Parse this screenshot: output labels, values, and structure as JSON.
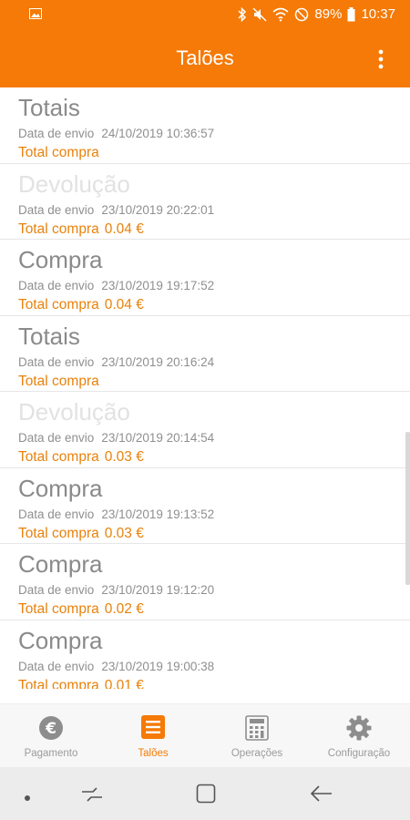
{
  "status_bar": {
    "battery": "89%",
    "time": "10:37"
  },
  "toolbar": {
    "title": "Talões"
  },
  "receipts": [
    {
      "type": "Totais",
      "date_label": "Data de envio",
      "date": "24/10/2019 10:36:57",
      "total_label": "Total compra",
      "amount": "",
      "faded": false
    },
    {
      "type": "Devolução",
      "date_label": "Data de envio",
      "date": "23/10/2019 20:22:01",
      "total_label": "Total compra",
      "amount": "0.04 €",
      "faded": true
    },
    {
      "type": "Compra",
      "date_label": "Data de envio",
      "date": "23/10/2019 19:17:52",
      "total_label": "Total compra",
      "amount": "0.04 €",
      "faded": false
    },
    {
      "type": "Totais",
      "date_label": "Data de envio",
      "date": "23/10/2019 20:16:24",
      "total_label": "Total compra",
      "amount": "",
      "faded": false
    },
    {
      "type": "Devolução",
      "date_label": "Data de envio",
      "date": "23/10/2019 20:14:54",
      "total_label": "Total compra",
      "amount": "0.03 €",
      "faded": true
    },
    {
      "type": "Compra",
      "date_label": "Data de envio",
      "date": "23/10/2019 19:13:52",
      "total_label": "Total compra",
      "amount": "0.03 €",
      "faded": false
    },
    {
      "type": "Compra",
      "date_label": "Data de envio",
      "date": "23/10/2019 19:12:20",
      "total_label": "Total compra",
      "amount": "0.02 €",
      "faded": false
    },
    {
      "type": "Compra",
      "date_label": "Data de envio",
      "date": "23/10/2019 19:00:38",
      "total_label": "Total compra",
      "amount": "0.01 €",
      "faded": false
    }
  ],
  "bottom_nav": [
    {
      "label": "Pagamento",
      "icon": "euro-icon",
      "active": false
    },
    {
      "label": "Talões",
      "icon": "receipt-list-icon",
      "active": true
    },
    {
      "label": "Operações",
      "icon": "calculator-icon",
      "active": false
    },
    {
      "label": "Configuração",
      "icon": "gear-icon",
      "active": false
    }
  ],
  "colors": {
    "accent": "#f57a07",
    "amount_text": "#e8820c",
    "faded_title": "#e2e2e2"
  }
}
